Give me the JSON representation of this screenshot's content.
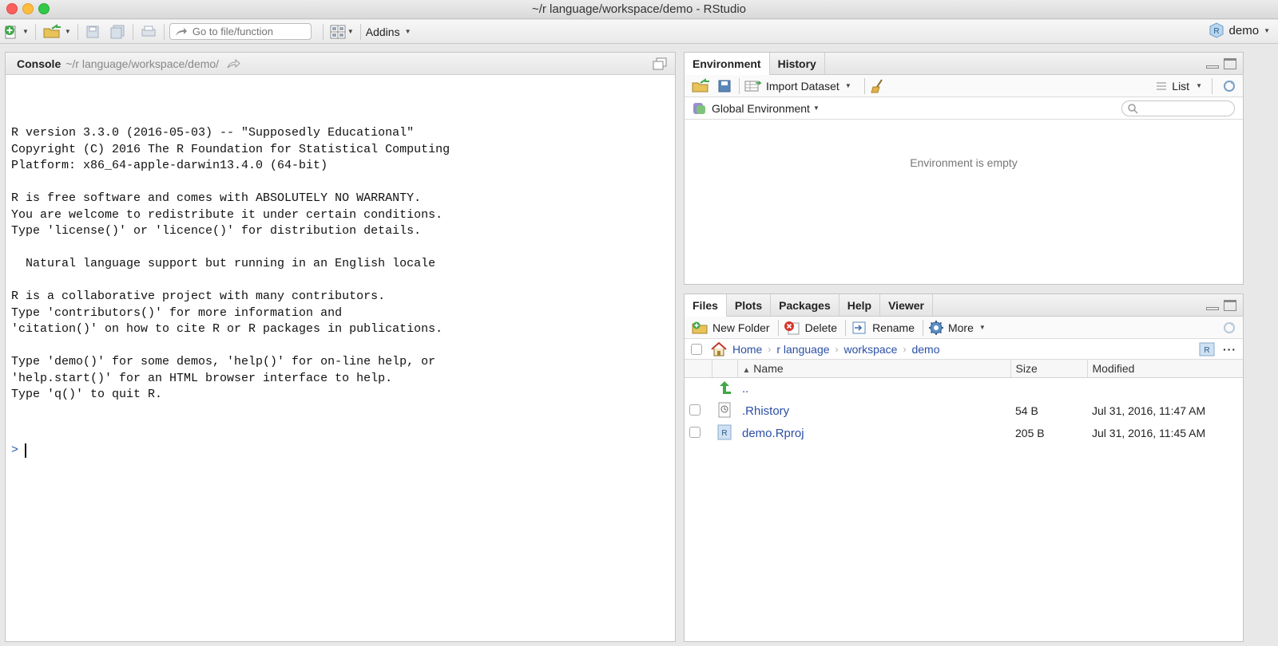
{
  "window": {
    "title": "~/r language/workspace/demo - RStudio"
  },
  "toolbar": {
    "goto_placeholder": "Go to file/function",
    "addins_label": "Addins",
    "project_label": "demo"
  },
  "console": {
    "title": "Console",
    "path": "~/r language/workspace/demo/",
    "output": "R version 3.3.0 (2016-05-03) -- \"Supposedly Educational\"\nCopyright (C) 2016 The R Foundation for Statistical Computing\nPlatform: x86_64-apple-darwin13.4.0 (64-bit)\n\nR is free software and comes with ABSOLUTELY NO WARRANTY.\nYou are welcome to redistribute it under certain conditions.\nType 'license()' or 'licence()' for distribution details.\n\n  Natural language support but running in an English locale\n\nR is a collaborative project with many contributors.\nType 'contributors()' for more information and\n'citation()' on how to cite R or R packages in publications.\n\nType 'demo()' for some demos, 'help()' for on-line help, or\n'help.start()' for an HTML browser interface to help.\nType 'q()' to quit R.",
    "prompt": ">"
  },
  "env_pane": {
    "tabs": [
      "Environment",
      "History"
    ],
    "import_label": "Import Dataset",
    "list_label": "List",
    "scope_label": "Global Environment",
    "empty_message": "Environment is empty"
  },
  "files_pane": {
    "tabs": [
      "Files",
      "Plots",
      "Packages",
      "Help",
      "Viewer"
    ],
    "actions": {
      "new_folder": "New Folder",
      "delete": "Delete",
      "rename": "Rename",
      "more": "More"
    },
    "breadcrumb": [
      "Home",
      "r language",
      "workspace",
      "demo"
    ],
    "columns": {
      "name": "Name",
      "size": "Size",
      "modified": "Modified"
    },
    "parent_dir": "..",
    "files": [
      {
        "name": ".Rhistory",
        "size": "54 B",
        "modified": "Jul 31, 2016, 11:47 AM",
        "icon": "history-file-icon"
      },
      {
        "name": "demo.Rproj",
        "size": "205 B",
        "modified": "Jul 31, 2016, 11:45 AM",
        "icon": "rproj-file-icon"
      }
    ]
  },
  "colors": {
    "link": "#2b4fa5",
    "prompt": "#2a5db0"
  }
}
